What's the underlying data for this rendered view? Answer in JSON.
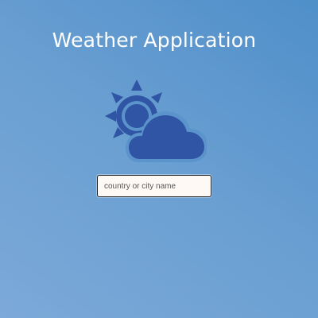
{
  "app": {
    "title": "Weather Application"
  },
  "icon": {
    "name": "partly-cloudy-icon",
    "color": "#2f55a4"
  },
  "search": {
    "placeholder": "country or city name",
    "value": ""
  },
  "colors": {
    "background_top_right": "#4f8fc9",
    "background_bottom_left": "#7ca9d8",
    "input_background": "#fff9f6"
  }
}
